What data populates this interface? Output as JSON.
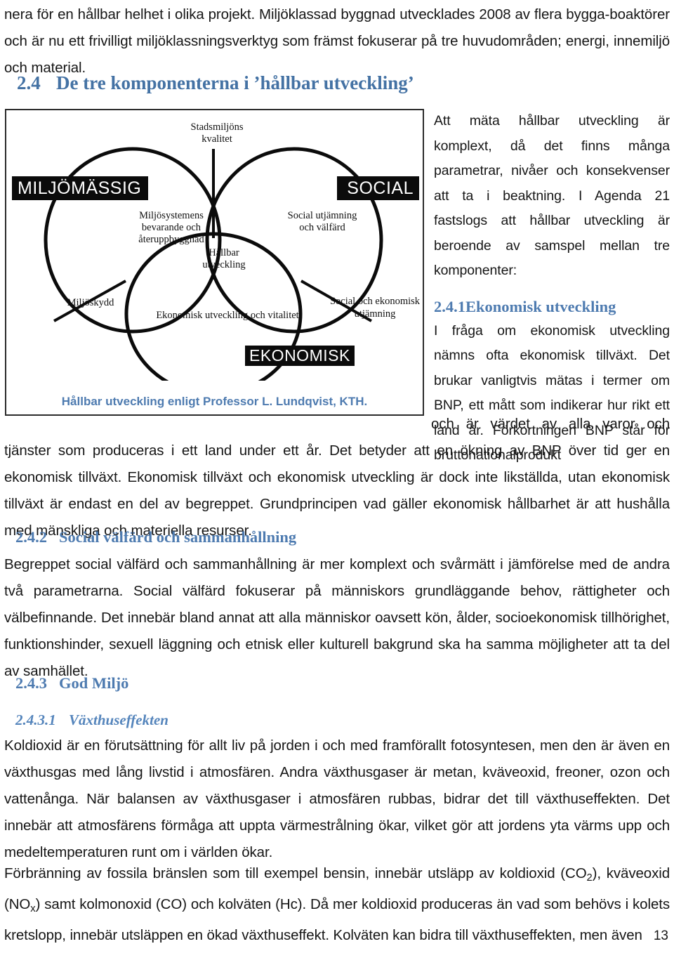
{
  "document": {
    "page_number": "13",
    "heading_color": "#4472A4",
    "body_color": "#161616"
  },
  "top_paragraph": {
    "text": "nera för en hållbar helhet i olika projekt. Miljöklassad byggnad utvecklades 2008 av flera bygga-boaktörer och är nu ett frivilligt miljöklassningsverktyg som främst fokuserar på tre huvudområden; energi, innemiljö och material."
  },
  "heading_24": {
    "number": "2.4",
    "title": "De tre komponenterna i ’hållbar utveckling’"
  },
  "figure": {
    "caption": "Hållbar utveckling enligt Professor L. Lundqvist, KTH.",
    "chips": {
      "environmental": "MILJÖMÄSSIG",
      "social": "SOCIAL",
      "economic": "EKONOMISK"
    },
    "labels": {
      "urban_quality": "Stadsmiljöns\nkvalitet",
      "eco_systems": "Miljösystemens\nbevarande och\nåteruppbyggnad",
      "social_equity": "Social utjämning\noch välfärd",
      "sustainable_dev": "Hållbar\nutveckling",
      "env_protection": "Miljöskydd",
      "econ_dev": "Ekonomisk utveckling och vitalitet",
      "social_econ": "Social och ekonomisk\nutjämning"
    }
  },
  "right_column": {
    "intro": "Att mäta hållbar utveckling är komplext, då det finns många parametrar, nivåer och konsekvenser att ta i beaktning. I Agenda 21 fastslogs att hållbar utveckling är beroende av samspel mellan tre komponenter:",
    "heading_241": {
      "number": "2.4.1",
      "title": "Ekonomisk utveckling"
    },
    "para_241_top": "I fråga om ekonomisk utveckling nämns ofta ekonomisk tillväxt. Det brukar vanligtvis mätas i termer om BNP, ett mått som indikerar hur rikt ett land är. Förkortningen BNP står för bruttonationalprodukt"
  },
  "after_figure": {
    "para_241_rest": "och är värdet av alla varor och tjänster som produceras i ett land under ett år. Det betyder att en ökning av BNP över tid ger en ekonomisk tillväxt. Ekonomisk tillväxt och ekonomisk utveckling är dock inte likställda, utan ekonomisk tillväxt är endast en del av begreppet. Grundprincipen vad gäller ekonomisk hållbarhet är att hushålla med mänskliga och materiella resurser."
  },
  "heading_242": {
    "number": "2.4.2",
    "title": "Social välfärd och sammanhållning"
  },
  "para_242": {
    "text": "Begreppet social välfärd och sammanhållning är mer komplext och svårmätt i jämförelse med de andra två parametrarna. Social välfärd fokuserar på människors grundläggande behov, rättigheter och välbefinnande. Det innebär bland annat att alla människor oavsett kön, ålder, socioekonomisk tillhörighet, funktionshinder, sexuell läggning och etnisk eller kulturell bakgrund ska ha samma möjligheter att ta del av samhället."
  },
  "heading_243": {
    "number": "2.4.3",
    "title": "God Miljö"
  },
  "heading_2431": {
    "number": "2.4.3.1",
    "title": "Växthuseffekten"
  },
  "para_2431": {
    "text": "Koldioxid är en förutsättning för allt liv på jorden i och med framförallt fotosyntesen, men den är även en växthusgas med lång livstid i atmosfären. Andra växthusgaser är metan, kväveoxid, freoner, ozon och vattenånga. När balansen av växthusgaser i atmosfären rubbas, bidrar det till växthuseffekten. Det innebär att atmosfärens förmåga att uppta värmestrålning ökar, vilket gör att jordens yta värms upp och medeltemperaturen runt om i världen ökar."
  },
  "para_fossil": {
    "part1": "Förbränning av fossila bränslen som till exempel bensin, innebär utsläpp av koldioxid (CO",
    "sub1": "2",
    "part2": "), kväveoxid (NO",
    "sub2": "x",
    "part3": ") samt kolmonoxid (CO) och kolväten (Hc). Då mer koldioxid produceras än vad som behövs i kolets kretslopp, innebär utsläppen en ökad växthuseffekt. Kolväten kan bidra till växthuseffekten, men även"
  }
}
